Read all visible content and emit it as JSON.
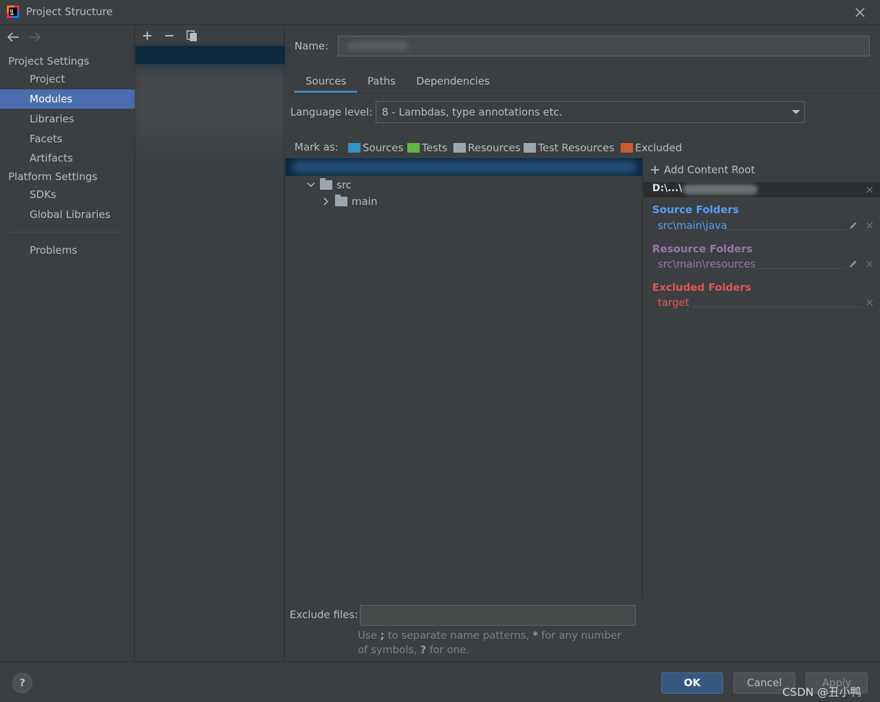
{
  "window": {
    "title": "Project Structure"
  },
  "nav": {
    "project_settings": "Project Settings",
    "project_items": [
      "Project",
      "Modules",
      "Libraries",
      "Facets",
      "Artifacts"
    ],
    "platform_settings": "Platform Settings",
    "platform_items": [
      "SDKs",
      "Global Libraries"
    ],
    "problems": "Problems",
    "selected": "Modules"
  },
  "module": {
    "name_label": "Name:",
    "name_value": ""
  },
  "tabs": [
    "Sources",
    "Paths",
    "Dependencies"
  ],
  "active_tab": "Sources",
  "language": {
    "label": "Language level:",
    "value": "8 - Lambdas, type annotations etc."
  },
  "mark_as": {
    "label": "Mark as:",
    "buttons": [
      "Sources",
      "Tests",
      "Resources",
      "Test Resources",
      "Excluded"
    ],
    "colors": {
      "sources": "#3592c4",
      "tests": "#62b543",
      "resources": "#9aa7b0",
      "test_resources": "#9aa7b0",
      "excluded": "#c75b2f"
    }
  },
  "tree": {
    "items": [
      "src",
      "main"
    ]
  },
  "content_root": {
    "add_label": "Add Content Root",
    "path": "D:\\...\\",
    "source_title": "Source Folders",
    "source_entry": "src\\main\\java",
    "resource_title": "Resource Folders",
    "resource_entry": "src\\main\\resources",
    "excluded_title": "Excluded Folders",
    "excluded_entry": "target",
    "colors": {
      "source": "#589df6",
      "resource": "#9876aa",
      "excluded": "#e05555"
    }
  },
  "exclude_files": {
    "label": "Exclude files:",
    "value": "",
    "hint_1": "Use ",
    "hint_sep": ";",
    "hint_2": " to separate name patterns, ",
    "hint_star": "*",
    "hint_3": " for any number of symbols, ",
    "hint_q": "?",
    "hint_4": " for one."
  },
  "buttons": {
    "help": "?",
    "ok": "OK",
    "cancel": "Cancel",
    "apply": "Apply"
  },
  "watermark": "CSDN @丑小鸭"
}
